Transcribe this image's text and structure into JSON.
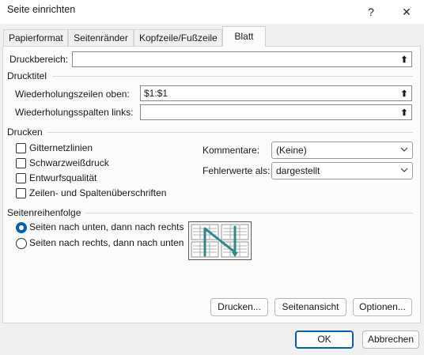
{
  "window": {
    "title": "Seite einrichten",
    "help_label": "?",
    "close_label": "✕"
  },
  "tabs": [
    {
      "label": "Papierformat"
    },
    {
      "label": "Seitenränder"
    },
    {
      "label": "Kopfzeile/Fußzeile"
    },
    {
      "label": "Blatt"
    }
  ],
  "print_area": {
    "label": "Druckbereich:",
    "value": "",
    "button_glyph": "⬆"
  },
  "print_titles": {
    "section": "Drucktitel",
    "rows_label": "Wiederholungszeilen oben:",
    "rows_value": "$1:$1",
    "cols_label": "Wiederholungsspalten links:",
    "cols_value": ""
  },
  "print": {
    "section": "Drucken",
    "checkboxes": [
      {
        "label": "Gitternetzlinien",
        "checked": false
      },
      {
        "label": "Schwarzweißdruck",
        "checked": false
      },
      {
        "label": "Entwurfsqualität",
        "checked": false
      },
      {
        "label": "Zeilen- und Spaltenüberschriften",
        "checked": false
      }
    ],
    "comments_label": "Kommentare:",
    "comments_value": "(Keine)",
    "errors_label": "Fehlerwerte als:",
    "errors_value": "dargestellt"
  },
  "page_order": {
    "section": "Seitenreihenfolge",
    "options": [
      {
        "label": "Seiten nach unten, dann nach rechts",
        "checked": true
      },
      {
        "label": "Seiten nach rechts, dann nach unten",
        "checked": false
      }
    ]
  },
  "buttons": {
    "print": "Drucken...",
    "preview": "Seitenansicht",
    "options": "Optionen...",
    "ok": "OK",
    "cancel": "Abbrechen"
  },
  "colors": {
    "accent": "#005fb8",
    "arrow": "#2a8a8a"
  }
}
